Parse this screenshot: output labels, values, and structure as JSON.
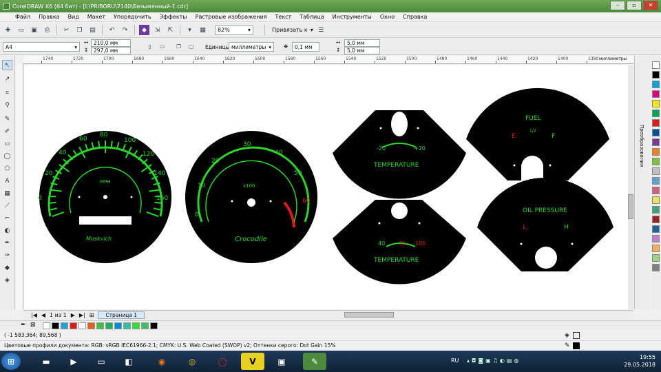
{
  "window": {
    "title": "CorelDRAW X6 (64 бит) - [I:\\PRIBORU\\2140\\Безымянный-1.cdr]",
    "buttons": [
      "–",
      "▫",
      "✕"
    ]
  },
  "menu": [
    "Файл",
    "Правка",
    "Вид",
    "Макет",
    "Упорядочить",
    "Эффекты",
    "Растровые изображения",
    "Текст",
    "Таблица",
    "Инструменты",
    "Окно",
    "Справка"
  ],
  "toolbar": {
    "zoom": "82%",
    "snap_label": "Привязать к"
  },
  "property_bar": {
    "page_size": "A4",
    "width": "210,0 мм",
    "height": "297,0 мм",
    "units_label": "Единицы:",
    "units_value": "миллиметры",
    "nudge": "0,1 мм",
    "dup_x": "5,0 мм",
    "dup_y": "5,0 мм"
  },
  "ruler": {
    "labels": [
      "1740",
      "1720",
      "1700",
      "1680",
      "1660",
      "1640",
      "1620",
      "1600",
      "1580",
      "1560",
      "1540",
      "1520",
      "1500",
      "1480",
      "1460",
      "1440",
      "1420",
      "1400",
      "1380"
    ],
    "unit": "миллиметры"
  },
  "docker": {
    "label": "Преобразования"
  },
  "gauges": {
    "speedo": {
      "ticks": [
        "0",
        "20",
        "40",
        "60",
        "80",
        "100",
        "120",
        "140",
        "160"
      ],
      "center_label": "MPH",
      "brand": "Moskvich"
    },
    "tacho": {
      "ticks": [
        "0",
        "10",
        "20",
        "30",
        "40",
        "50",
        "60"
      ],
      "center_label": "x100",
      "brand": "Crocodile"
    },
    "temp_top": {
      "left": "-20",
      "right": "+20",
      "label": "TEMPERATURE"
    },
    "fuel": {
      "label": "FUEL",
      "left": "E",
      "mid": "1/2",
      "right": "F"
    },
    "temp_bottom": {
      "left": "40",
      "mid": "75",
      "right": "100",
      "label": "TEMPERATURE"
    },
    "oil": {
      "label": "OIL PRESSURE",
      "left": "L",
      "right": "H"
    }
  },
  "pager": {
    "count": "1 из 1",
    "tab": "Страница 1"
  },
  "status": {
    "coords": "( -1 583,364; 89,568 )",
    "profiles": "Цветовые профили документа: RGB: sRGB IEC61966-2.1; CMYK: U.S. Web Coated (SWOP) v2; Оттенки серого: Dot Gain 15%"
  },
  "taskbar": {
    "lang": "RU",
    "time": "19:55",
    "date": "29.05.2018"
  },
  "colors": {
    "accent_green": "#2bd62b",
    "accent_red": "#e01a1a",
    "title_green": "#5a9a48"
  }
}
